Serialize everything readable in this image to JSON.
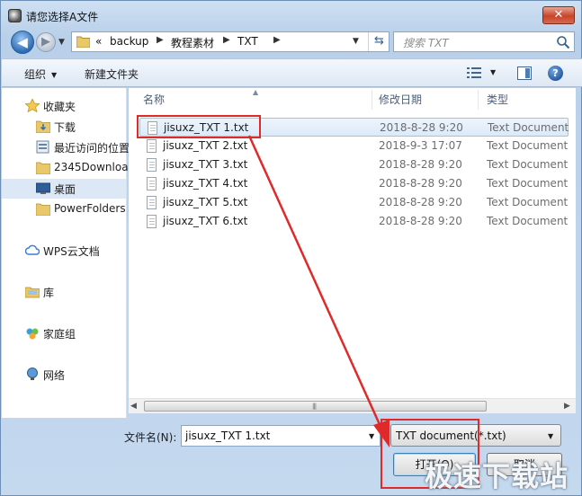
{
  "window": {
    "title": "请您选择A文件",
    "close_label": "✕"
  },
  "address_bar": {
    "overflow": "«",
    "crumbs": [
      "backup",
      "教程素材",
      "TXT"
    ]
  },
  "search": {
    "placeholder": "搜索 TXT"
  },
  "toolbar": {
    "organize_label": "组织",
    "new_folder_label": "新建文件夹"
  },
  "nav": {
    "items": [
      {
        "label": "收藏夹",
        "icon": "star-icon"
      },
      {
        "label": "下载",
        "icon": "download-folder-icon"
      },
      {
        "label": "最近访问的位置",
        "icon": "recent-places-icon"
      },
      {
        "label": "2345Downloa",
        "icon": "folder-icon"
      },
      {
        "label": "桌面",
        "icon": "desktop-icon"
      },
      {
        "label": "PowerFolders",
        "icon": "folder-icon"
      },
      {
        "label": "WPS云文档",
        "icon": "cloud-icon"
      },
      {
        "label": "库",
        "icon": "library-icon"
      },
      {
        "label": "家庭组",
        "icon": "homegroup-icon"
      },
      {
        "label": "网络",
        "icon": "network-icon"
      }
    ],
    "selected": "桌面"
  },
  "columns": {
    "name": "名称",
    "date": "修改日期",
    "type": "类型"
  },
  "files": [
    {
      "name": "jisuxz_TXT 1.txt",
      "date": "2018-8-28 9:20",
      "type": "Text Document"
    },
    {
      "name": "jisuxz_TXT 2.txt",
      "date": "2018-9-3 17:07",
      "type": "Text Document"
    },
    {
      "name": "jisuxz_TXT 3.txt",
      "date": "2018-8-28 9:20",
      "type": "Text Document"
    },
    {
      "name": "jisuxz_TXT 4.txt",
      "date": "2018-8-28 9:20",
      "type": "Text Document"
    },
    {
      "name": "jisuxz_TXT 5.txt",
      "date": "2018-8-28 9:20",
      "type": "Text Document"
    },
    {
      "name": "jisuxz_TXT 6.txt",
      "date": "2018-8-28 9:20",
      "type": "Text Document"
    }
  ],
  "bottom": {
    "filename_label": "文件名(N):",
    "filename_value": "jisuxz_TXT 1.txt",
    "filetype_value": "TXT document(*.txt)",
    "open_label": "打开(O)",
    "cancel_label": "取消"
  },
  "watermark": "极速下载站",
  "colors": {
    "annotation": "#e02a2a",
    "selection": "#dbeaf9",
    "chrome": "#c4d8ee"
  }
}
